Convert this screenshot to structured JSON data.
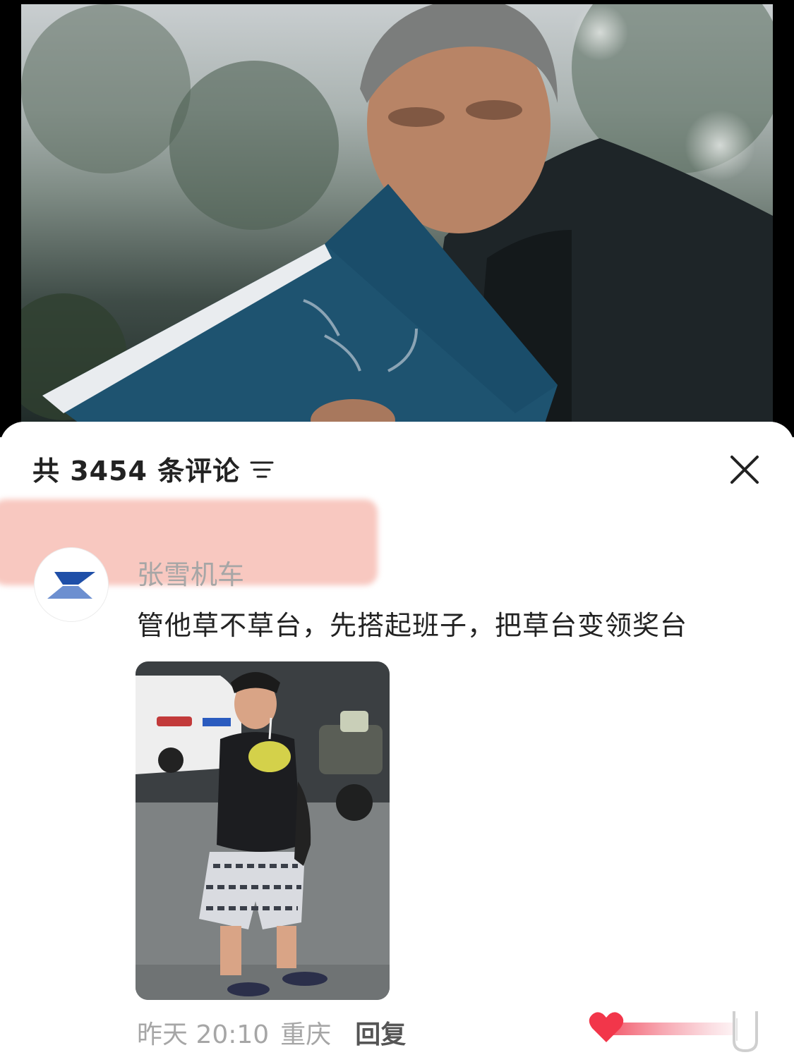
{
  "comments_panel": {
    "count_label": "共 3454 条评论",
    "sort_icon": "sort-lines-icon",
    "close_icon": "close-icon"
  },
  "comment": {
    "username": "张雪机车",
    "text": "管他草不草台，先搭起班子，把草台变领奖台",
    "time": "昨天 20:10",
    "location": "重庆",
    "reply_label": "回复",
    "like_icon": "heart-icon"
  },
  "colors": {
    "highlight": "#f4aa9e",
    "heart": "#f2364a",
    "username": "#a6a6a6",
    "text": "#222222"
  }
}
